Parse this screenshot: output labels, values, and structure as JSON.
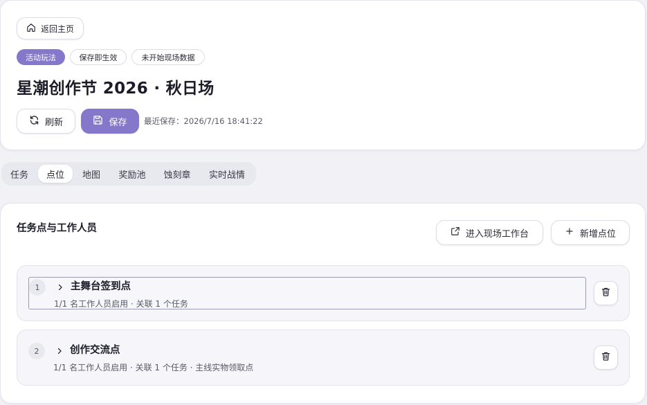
{
  "header": {
    "back_label": "返回主页",
    "tags": [
      "活动玩法",
      "保存即生效",
      "未开始现场数据"
    ],
    "title": "星潮创作节 2026 · 秋日场",
    "refresh_label": "刷新",
    "save_label": "保存",
    "last_saved": "最近保存：2026/7/16 18:41:22"
  },
  "tabs": [
    {
      "label": "任务",
      "active": false
    },
    {
      "label": "点位",
      "active": true
    },
    {
      "label": "地图",
      "active": false
    },
    {
      "label": "奖励池",
      "active": false
    },
    {
      "label": "蚀刻章",
      "active": false
    },
    {
      "label": "实时战情",
      "active": false
    }
  ],
  "section": {
    "title": "任务点与工作人员",
    "workspace_label": "进入现场工作台",
    "add_point_label": "新增点位",
    "points": [
      {
        "index": "1",
        "name": "主舞台签到点",
        "desc": "1/1 名工作人员启用 · 关联 1 个任务"
      },
      {
        "index": "2",
        "name": "创作交流点",
        "desc": "1/1 名工作人员启用 · 关联 1 个任务 · 主线实物领取点"
      }
    ]
  },
  "icons": {
    "back": "home-icon",
    "refresh": "refresh-icon",
    "save": "save-icon",
    "workspace": "external-link-icon",
    "add": "plus-icon",
    "expand": "chevron-right-icon",
    "delete": "trash-icon"
  },
  "colors": {
    "accent": "#8577c9",
    "background": "#f1f1f6",
    "card": "#ffffff"
  }
}
